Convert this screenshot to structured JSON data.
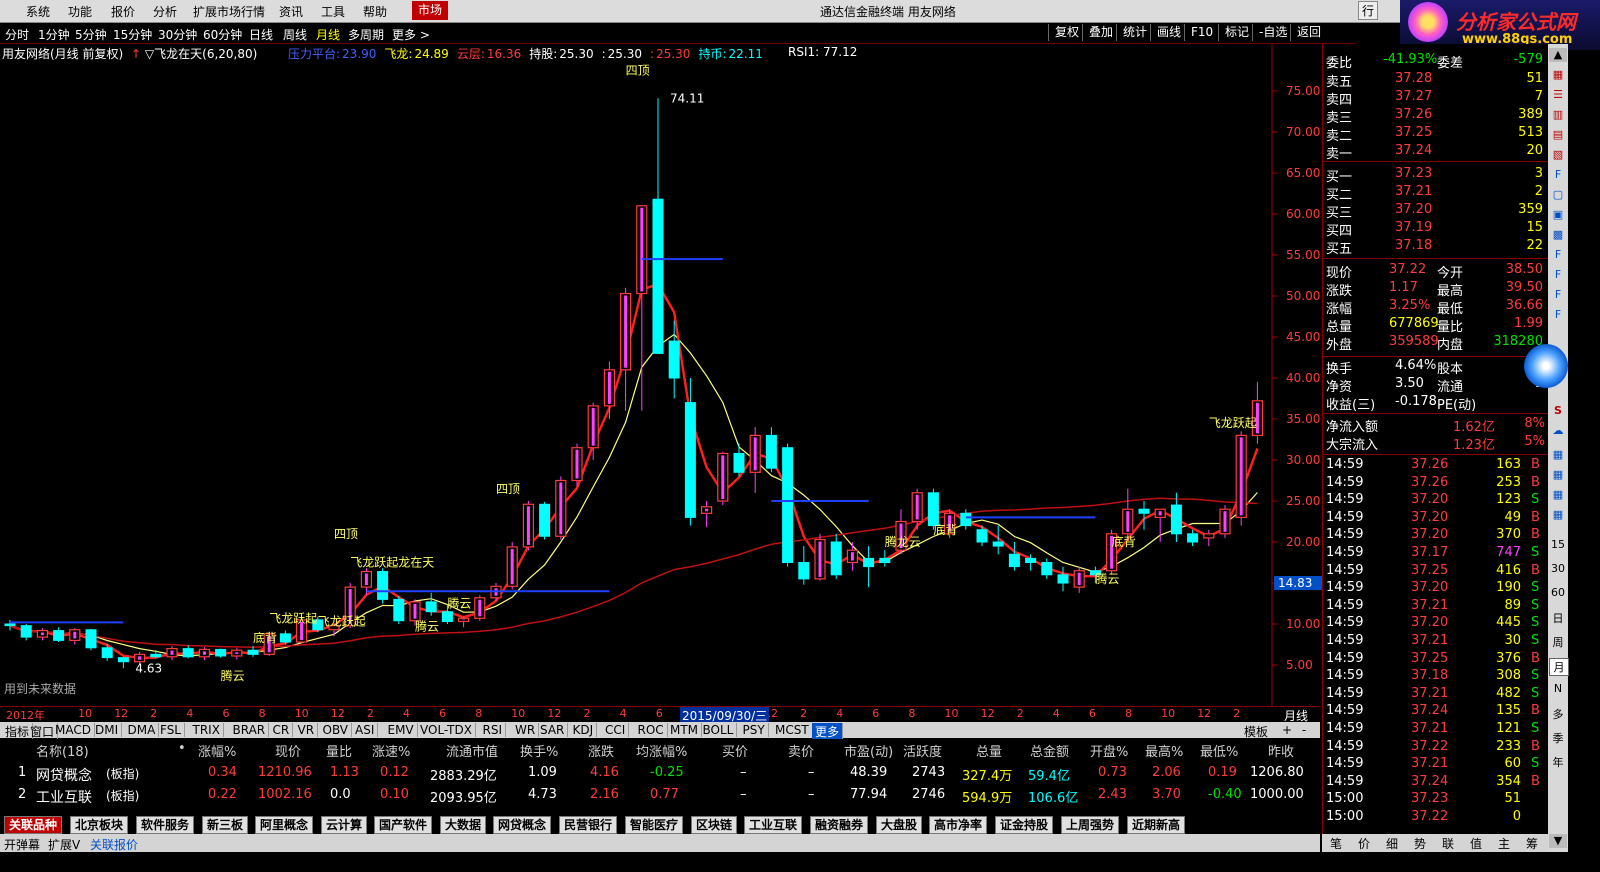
{
  "menu": {
    "items": [
      "系统",
      "功能",
      "报价",
      "分析",
      "扩展市场行情",
      "资讯",
      "工具",
      "帮助"
    ],
    "market": "市场",
    "title": "通达信金融终端  用友网络",
    "right_btn": "行"
  },
  "logo": {
    "text": "分析家公式网",
    "url": "www.88gs.com"
  },
  "periods": [
    "分时",
    "1分钟",
    "5分钟",
    "15分钟",
    "30分钟",
    "60分钟",
    "日线",
    "周线",
    "月线",
    "多周期",
    "更多 >"
  ],
  "selected_period": "月线",
  "toolbar_right": [
    "复权",
    "叠加",
    "统计",
    "画线",
    "F10",
    "标记",
    "-自选",
    "返回"
  ],
  "chart_header": {
    "stock": "用友网络(月线 前复权)",
    "formula": "▽飞龙在天(6,20,80)",
    "items": [
      {
        "label": "压力平台:",
        "value": "23.90",
        "color": "#4060ff"
      },
      {
        "label": "飞龙:",
        "value": "24.89",
        "color": "#ffff00"
      },
      {
        "label": "云层:",
        "value": "16.36",
        "color": "#ff3c3c"
      },
      {
        "label": "持股:",
        "value": "25.30",
        "color": "#ffffff"
      },
      {
        "label": ":",
        "value": "25.30",
        "color": "#ffffff"
      },
      {
        "label": ":",
        "value": "25.30",
        "color": "#ff3c3c"
      },
      {
        "label": "持币:",
        "value": "22.11",
        "color": "#00ffff"
      }
    ],
    "rsi": "RSI1: 77.12"
  },
  "chart_notes": {
    "future_data": "用到未来数据",
    "low_label": "4.63",
    "high_label": "74.11",
    "price_tag": "14.83",
    "date_label": "2015/09/30/三",
    "axis_unit": "月线"
  },
  "chart_data": {
    "type": "candlestick",
    "ylim": [
      0,
      80
    ],
    "yticks": [
      "75.00",
      "70.00",
      "65.00",
      "60.00",
      "55.00",
      "50.00",
      "45.00",
      "40.00",
      "35.00",
      "30.00",
      "25.00",
      "20.00",
      "15.00",
      "10.00",
      "5.00"
    ],
    "ytick_values": [
      75,
      70,
      65,
      60,
      55,
      50,
      45,
      40,
      35,
      30,
      25,
      20,
      15,
      10,
      5
    ],
    "xticks": [
      "2012年",
      "10",
      "12",
      "2",
      "4",
      "6",
      "8",
      "10",
      "12",
      "2",
      "4",
      "6",
      "8",
      "10",
      "12",
      "2",
      "4",
      "6",
      "8",
      "10",
      "12",
      "2",
      "4",
      "6",
      "8",
      "10",
      "12",
      "2",
      "4",
      "6",
      "8",
      "10",
      "12",
      "2"
    ],
    "candles": [
      [
        10.0,
        10.5,
        9.2,
        9.8
      ],
      [
        9.8,
        10.0,
        8.0,
        8.4
      ],
      [
        8.4,
        9.5,
        8.0,
        9.2
      ],
      [
        9.2,
        9.6,
        7.8,
        8.0
      ],
      [
        8.0,
        9.5,
        7.5,
        9.3
      ],
      [
        9.3,
        9.4,
        6.8,
        7.1
      ],
      [
        7.1,
        7.6,
        5.5,
        5.9
      ],
      [
        5.9,
        6.0,
        4.6,
        5.4
      ],
      [
        5.4,
        6.6,
        5.1,
        6.3
      ],
      [
        6.3,
        6.8,
        5.8,
        6.0
      ],
      [
        6.0,
        7.3,
        5.6,
        7.0
      ],
      [
        7.0,
        7.4,
        5.8,
        6.0
      ],
      [
        6.0,
        7.2,
        5.6,
        6.9
      ],
      [
        6.9,
        7.0,
        5.9,
        6.1
      ],
      [
        6.1,
        7.1,
        5.7,
        6.8
      ],
      [
        6.8,
        7.3,
        6.0,
        6.3
      ],
      [
        6.3,
        9.0,
        6.1,
        8.8
      ],
      [
        8.8,
        9.2,
        7.5,
        7.8
      ],
      [
        7.8,
        10.8,
        7.6,
        10.5
      ],
      [
        10.5,
        10.9,
        9.0,
        9.3
      ],
      [
        9.3,
        10.0,
        8.5,
        9.8
      ],
      [
        9.8,
        15.0,
        9.5,
        14.5
      ],
      [
        14.5,
        16.8,
        13.5,
        16.4
      ],
      [
        16.4,
        16.8,
        12.5,
        13.0
      ],
      [
        13.0,
        13.4,
        10.0,
        10.4
      ],
      [
        10.4,
        13.0,
        9.8,
        12.7
      ],
      [
        12.7,
        13.8,
        11.0,
        11.5
      ],
      [
        11.5,
        12.4,
        10.0,
        10.3
      ],
      [
        10.3,
        11.0,
        9.6,
        10.7
      ],
      [
        10.7,
        13.5,
        10.4,
        13.2
      ],
      [
        13.2,
        15.0,
        12.8,
        14.6
      ],
      [
        14.6,
        20.0,
        14.2,
        19.4
      ],
      [
        19.4,
        25.0,
        19.0,
        24.6
      ],
      [
        24.6,
        24.9,
        20.3,
        20.7
      ],
      [
        20.7,
        28.0,
        20.3,
        27.5
      ],
      [
        27.5,
        32.0,
        26.8,
        31.5
      ],
      [
        31.5,
        37.0,
        30.0,
        36.6
      ],
      [
        36.6,
        42.0,
        35.0,
        41.0
      ],
      [
        41.0,
        51.0,
        36.0,
        50.3
      ],
      [
        50.3,
        61.0,
        36.0,
        61.0
      ],
      [
        61.8,
        74.11,
        43.0,
        43.0
      ],
      [
        44.5,
        47.0,
        37.5,
        40.0
      ],
      [
        37.0,
        40.0,
        22.0,
        23.0
      ],
      [
        23.5,
        25.0,
        21.8,
        24.3
      ],
      [
        25.0,
        31.0,
        24.5,
        30.8
      ],
      [
        30.8,
        32.0,
        28.0,
        28.5
      ],
      [
        28.5,
        34.0,
        26.0,
        33.0
      ],
      [
        33.0,
        34.0,
        28.5,
        29.0
      ],
      [
        31.5,
        32.0,
        17.0,
        17.5
      ],
      [
        17.5,
        19.5,
        14.8,
        15.5
      ],
      [
        15.5,
        21.0,
        15.3,
        20.3
      ],
      [
        20.0,
        21.0,
        15.5,
        16.0
      ],
      [
        17.5,
        20.0,
        16.5,
        19.0
      ],
      [
        18.0,
        19.5,
        14.5,
        17.0
      ],
      [
        18.0,
        19.0,
        17.0,
        17.5
      ],
      [
        19.0,
        24.0,
        18.5,
        22.5
      ],
      [
        22.5,
        26.5,
        21.5,
        26.0
      ],
      [
        26.0,
        26.5,
        21.5,
        22.0
      ],
      [
        21.0,
        24.0,
        20.5,
        23.5
      ],
      [
        23.5,
        24.0,
        21.5,
        22.0
      ],
      [
        21.5,
        22.0,
        19.5,
        20.0
      ],
      [
        20.0,
        22.0,
        18.5,
        19.5
      ],
      [
        18.5,
        20.0,
        16.5,
        17.0
      ],
      [
        18.0,
        18.5,
        16.5,
        17.5
      ],
      [
        17.5,
        18.0,
        15.5,
        16.0
      ],
      [
        16.0,
        17.0,
        14.0,
        15.0
      ],
      [
        14.5,
        17.0,
        13.8,
        16.5
      ],
      [
        16.5,
        17.0,
        15.0,
        16.0
      ],
      [
        16.5,
        21.5,
        16.0,
        21.0
      ],
      [
        21.0,
        26.5,
        20.5,
        24.0
      ],
      [
        24.0,
        25.0,
        21.5,
        23.5
      ],
      [
        23.0,
        24.0,
        20.0,
        24.0
      ],
      [
        24.5,
        26.0,
        20.0,
        21.0
      ],
      [
        21.0,
        21.5,
        19.5,
        20.0
      ],
      [
        20.5,
        21.5,
        19.5,
        21.0
      ],
      [
        21.0,
        24.5,
        20.5,
        24.0
      ],
      [
        23.0,
        33.5,
        22.0,
        33.0
      ],
      [
        33.0,
        39.5,
        32.0,
        37.22
      ]
    ],
    "labels": [
      {
        "text": "飞龙跃起",
        "x": 16,
        "y": 10.2
      },
      {
        "text": "飞龙跃起",
        "x": 19,
        "y": 9.8
      },
      {
        "text": "底背",
        "x": 15,
        "y": 7.8
      },
      {
        "text": "腾云",
        "x": 13,
        "y": 3.2
      },
      {
        "text": "飞龙跃起龙在天",
        "x": 21,
        "y": 17.0
      },
      {
        "text": "腾云",
        "x": 25,
        "y": 9.2
      },
      {
        "text": "腾云",
        "x": 27,
        "y": 12.0
      },
      {
        "text": "四顶",
        "x": 20,
        "y": 20.5
      },
      {
        "text": "四顶",
        "x": 30,
        "y": 26.0
      },
      {
        "text": "四顶",
        "x": 38,
        "y": 77.0
      },
      {
        "text": "腾龙云",
        "x": 54,
        "y": 19.5
      },
      {
        "text": "底背",
        "x": 57,
        "y": 21.0
      },
      {
        "text": "腾云",
        "x": 67,
        "y": 15.0
      },
      {
        "text": "底背",
        "x": 68,
        "y": 19.5
      },
      {
        "text": "飞龙跃起",
        "x": 74,
        "y": 34.0
      }
    ]
  },
  "indicator_tabs": [
    "指标",
    "窗口",
    "MACD",
    "DMI",
    "DMA",
    "FSL",
    "TRIX",
    "BRAR",
    "CR",
    "VR",
    "OBV",
    "ASI",
    "EMV",
    "VOL-TDX",
    "RSI",
    "WR",
    "SAR",
    "KDJ",
    "CCI",
    "ROC",
    "MTM",
    "BOLL",
    "PSY",
    "MCST",
    "更多"
  ],
  "indicator_right": [
    "模板",
    "+",
    "-"
  ],
  "grid": {
    "headers": [
      "名称(18)",
      "•",
      "涨幅%",
      "现价",
      "量比",
      "涨速%",
      "流通市值",
      "换手%",
      "涨跌",
      "均涨幅%",
      "买价",
      "卖价",
      "市盈(动)",
      "活跃度",
      "总量",
      "总金额",
      "开盘%",
      "最高%",
      "最低%",
      "昨收"
    ],
    "rows": [
      {
        "idx": "1",
        "name": "网贷概念",
        "type": "(板指)",
        "chg": "0.34",
        "price": "1210.96",
        "vr": "1.13",
        "spd": "0.12",
        "mcap": "2883.29亿",
        "turn": "1.09",
        "diff": "4.16",
        "avg": "-0.25",
        "bid": "–",
        "ask": "–",
        "pe": "48.39",
        "act": "2743",
        "vol": "327.4万",
        "amt": "59.4亿",
        "open": "0.73",
        "high": "2.06",
        "low": "0.19",
        "prev": "1206.80"
      },
      {
        "idx": "2",
        "name": "工业互联",
        "type": "(板指)",
        "chg": "0.22",
        "price": "1002.16",
        "vr": "0.0",
        "spd": "0.10",
        "mcap": "2093.95亿",
        "turn": "4.73",
        "diff": "2.16",
        "avg": "0.77",
        "bid": "–",
        "ask": "–",
        "pe": "77.94",
        "act": "2746",
        "vol": "594.9万",
        "amt": "106.6亿",
        "open": "2.43",
        "high": "3.70",
        "low": "-0.40",
        "prev": "1000.00"
      }
    ]
  },
  "concept_tabs": [
    "关联品种",
    "北京板块",
    "软件服务",
    "新三板",
    "阿里概念",
    "云计算",
    "国产软件",
    "大数据",
    "网贷概念",
    "民营银行",
    "智能医疗",
    "区块链",
    "工业互联",
    "融资融券",
    "大盘股",
    "高市净率",
    "证金持股",
    "上周强势",
    "近期新高"
  ],
  "status_bar": [
    "开弹幕",
    "扩展V",
    "关联报价"
  ],
  "quote": {
    "weibi": {
      "label": "委比",
      "value": "-41.93%",
      "label2": "委差",
      "value2": "-579"
    },
    "asks": [
      {
        "label": "卖五",
        "price": "37.28",
        "vol": "51"
      },
      {
        "label": "卖四",
        "price": "37.27",
        "vol": "7"
      },
      {
        "label": "卖三",
        "price": "37.26",
        "vol": "389"
      },
      {
        "label": "卖二",
        "price": "37.25",
        "vol": "513"
      },
      {
        "label": "卖一",
        "price": "37.24",
        "vol": "20"
      }
    ],
    "bids": [
      {
        "label": "买一",
        "price": "37.23",
        "vol": "3"
      },
      {
        "label": "买二",
        "price": "37.21",
        "vol": "2"
      },
      {
        "label": "买三",
        "price": "37.20",
        "vol": "359"
      },
      {
        "label": "买四",
        "price": "37.19",
        "vol": "15"
      },
      {
        "label": "买五",
        "price": "37.18",
        "vol": "22"
      }
    ],
    "stats": [
      {
        "l1": "现价",
        "v1": "37.22",
        "c1": "#ff3c3c",
        "l2": "今开",
        "v2": "38.50",
        "c2": "#ff3c3c"
      },
      {
        "l1": "涨跌",
        "v1": "1.17",
        "c1": "#ff3c3c",
        "l2": "最高",
        "v2": "39.50",
        "c2": "#ff3c3c"
      },
      {
        "l1": "涨幅",
        "v1": "3.25%",
        "c1": "#ff3c3c",
        "l2": "最低",
        "v2": "36.66",
        "c2": "#ff3c3c"
      },
      {
        "l1": "总量",
        "v1": "677869",
        "c1": "#ffff00",
        "l2": "量比",
        "v2": "1.99",
        "c2": "#ff3c3c"
      },
      {
        "l1": "外盘",
        "v1": "359589",
        "c1": "#ff3c3c",
        "l2": "内盘",
        "v2": "318280",
        "c2": "#00e000"
      }
    ],
    "stats2": [
      {
        "l1": "换手",
        "v1": "4.64%",
        "l2": "股本",
        "v2": "1"
      },
      {
        "l1": "净资",
        "v1": "3.50",
        "l2": "流通",
        "v2": "1"
      },
      {
        "l1": "收益(三)",
        "v1": "-0.178",
        "l2": "PE(动)",
        "v2": ""
      }
    ],
    "flows": [
      {
        "label": "净流入额",
        "value": "1.62亿",
        "pct": "8%"
      },
      {
        "label": "大宗流入",
        "value": "1.23亿",
        "pct": "5%"
      }
    ],
    "ticks": [
      {
        "t": "14:59",
        "p": "37.26",
        "v": "163",
        "d": "B"
      },
      {
        "t": "14:59",
        "p": "37.26",
        "v": "253",
        "d": "B"
      },
      {
        "t": "14:59",
        "p": "37.20",
        "v": "123",
        "d": "S"
      },
      {
        "t": "14:59",
        "p": "37.20",
        "v": "49",
        "d": "B"
      },
      {
        "t": "14:59",
        "p": "37.20",
        "v": "370",
        "d": "B"
      },
      {
        "t": "14:59",
        "p": "37.17",
        "v": "747",
        "d": "S"
      },
      {
        "t": "14:59",
        "p": "37.25",
        "v": "416",
        "d": "B"
      },
      {
        "t": "14:59",
        "p": "37.20",
        "v": "190",
        "d": "S"
      },
      {
        "t": "14:59",
        "p": "37.21",
        "v": "89",
        "d": "S"
      },
      {
        "t": "14:59",
        "p": "37.20",
        "v": "445",
        "d": "S"
      },
      {
        "t": "14:59",
        "p": "37.21",
        "v": "30",
        "d": "S"
      },
      {
        "t": "14:59",
        "p": "37.25",
        "v": "376",
        "d": "B"
      },
      {
        "t": "14:59",
        "p": "37.18",
        "v": "308",
        "d": "S"
      },
      {
        "t": "14:59",
        "p": "37.21",
        "v": "482",
        "d": "S"
      },
      {
        "t": "14:59",
        "p": "37.24",
        "v": "135",
        "d": "B"
      },
      {
        "t": "14:59",
        "p": "37.21",
        "v": "121",
        "d": "S"
      },
      {
        "t": "14:59",
        "p": "37.22",
        "v": "233",
        "d": "B"
      },
      {
        "t": "14:59",
        "p": "37.21",
        "v": "60",
        "d": "S"
      },
      {
        "t": "14:59",
        "p": "37.24",
        "v": "354",
        "d": "B"
      },
      {
        "t": "15:00",
        "p": "37.23",
        "v": "51",
        "d": ""
      },
      {
        "t": "15:00",
        "p": "37.22",
        "v": "0",
        "d": ""
      }
    ]
  },
  "right_bottom_tabs": [
    "笔",
    "价",
    "细",
    "势",
    "联",
    "值",
    "主",
    "筹"
  ],
  "side_toolbar": [
    "15",
    "30",
    "60",
    "日",
    "周",
    "月",
    "N",
    "多",
    "季",
    "年"
  ]
}
